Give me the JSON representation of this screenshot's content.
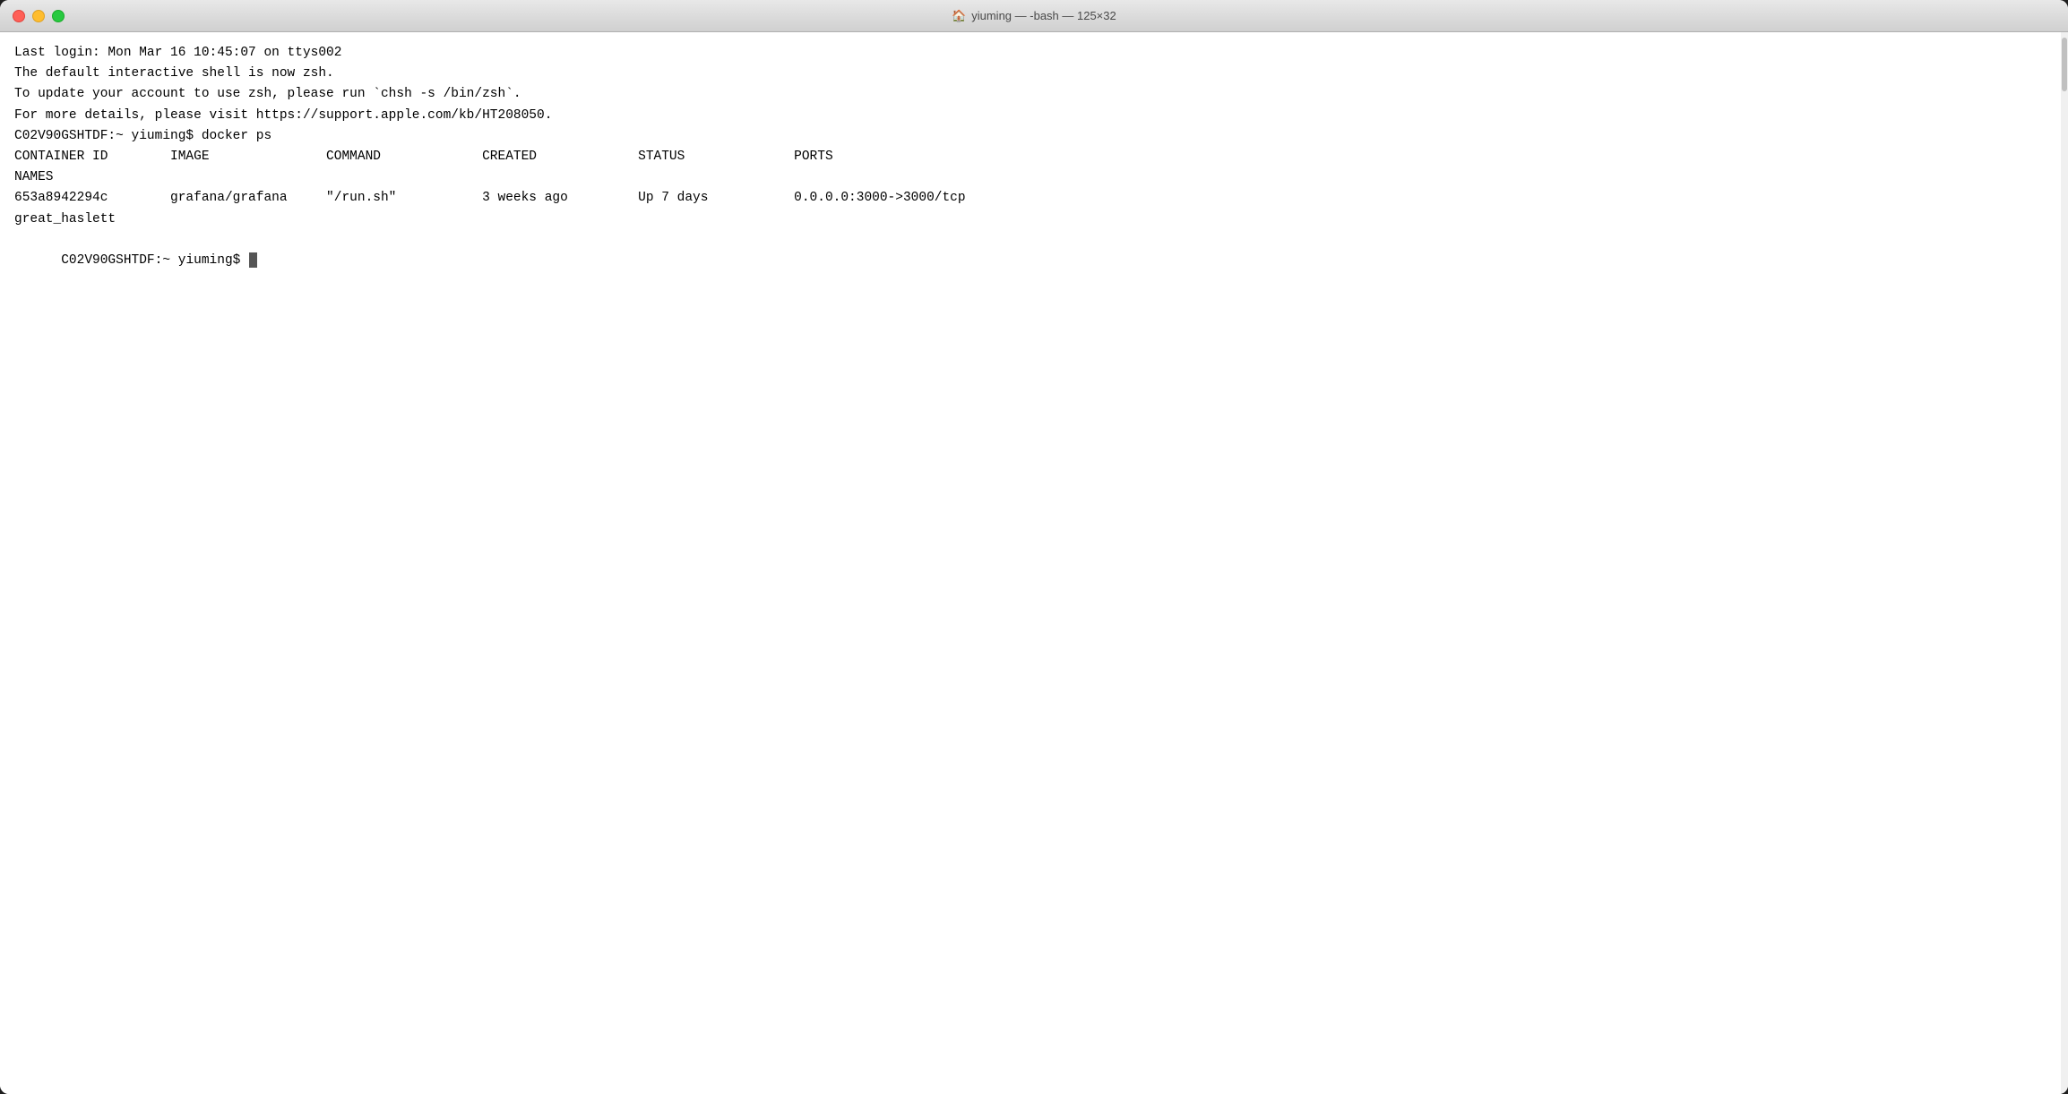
{
  "window": {
    "title": "yiuming — -bash — 125×32",
    "icon": "🏠"
  },
  "terminal": {
    "lines": [
      "Last login: Mon Mar 16 10:45:07 on ttys002",
      "",
      "The default interactive shell is now zsh.",
      "To update your account to use zsh, please run `chsh -s /bin/zsh`.",
      "For more details, please visit https://support.apple.com/kb/HT208050.",
      "C02V90GSHTDF:~ yiuming$ docker ps",
      "CONTAINER ID        IMAGE               COMMAND             CREATED             STATUS              PORTS",
      "NAMES",
      "653a8942294c        grafana/grafana     \"/run.sh\"           3 weeks ago         Up 7 days           0.0.0.0:3000->3000/tcp",
      "great_haslett",
      "C02V90GSHTDF:~ yiuming$ "
    ],
    "prompt": "C02V90GSHTDF:~ yiuming$ "
  },
  "traffic_lights": {
    "close_label": "close",
    "minimize_label": "minimize",
    "maximize_label": "maximize"
  }
}
